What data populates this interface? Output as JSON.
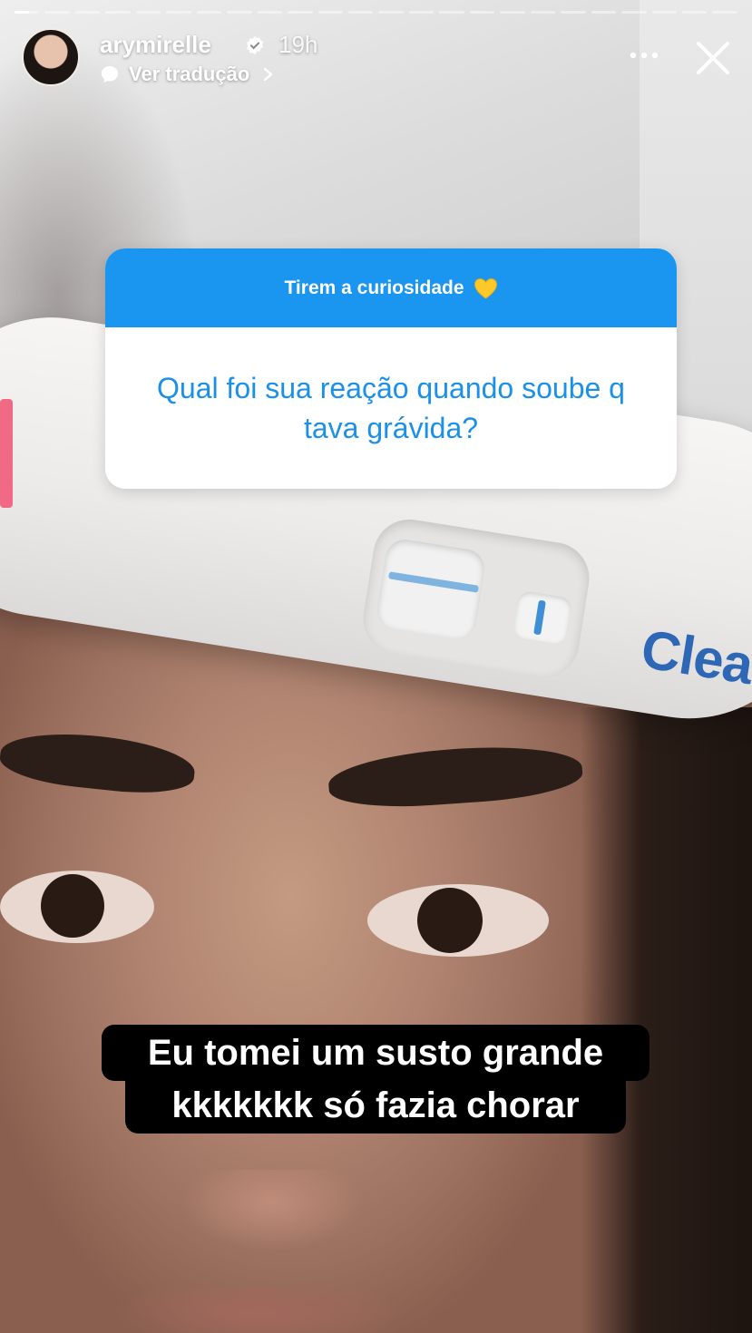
{
  "story": {
    "username": "arymirelle",
    "verified": true,
    "time_ago": "19h",
    "translate_label": "Ver tradução",
    "progress_segments": 24,
    "active_segment_index": 0
  },
  "question_sticker": {
    "header": "Tirem a curiosidade",
    "header_emoji": "yellow-heart-icon",
    "question": "Qual foi sua reação quando soube q tava grávida?",
    "header_color": "#1a95f0",
    "question_color": "#1b90e8"
  },
  "caption": {
    "line1": "Eu tomei um susto grande",
    "line2": "kkkkkkk só fazia chorar"
  },
  "photo": {
    "brand_text": "Clea"
  },
  "icons": {
    "more": "more-horizontal-icon",
    "close": "close-icon",
    "translate": "translate-bubble-icon",
    "chevron": "chevron-right-icon"
  }
}
